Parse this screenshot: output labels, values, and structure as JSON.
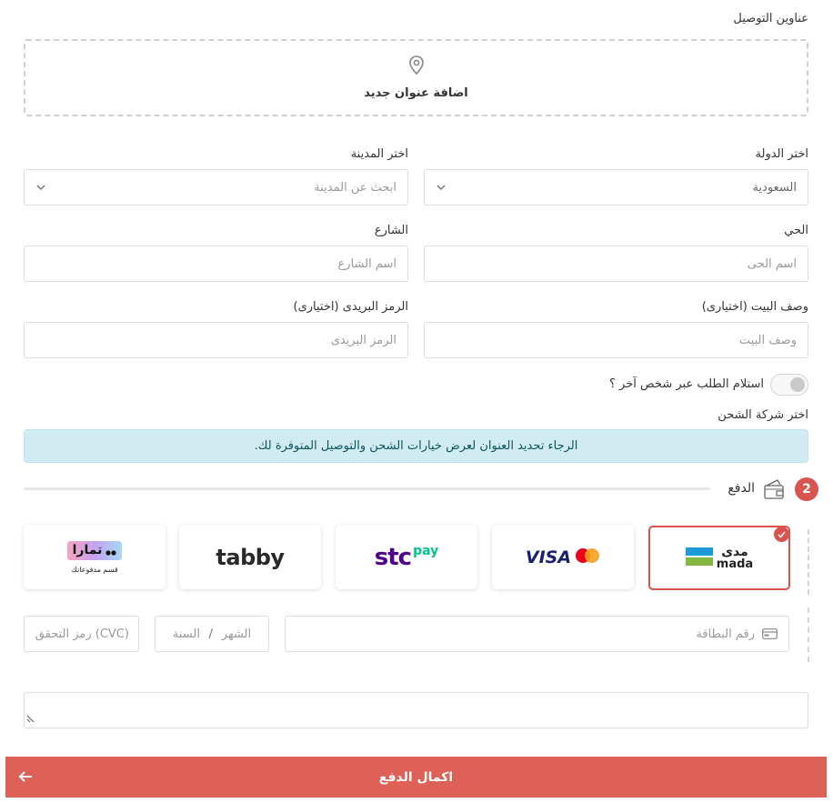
{
  "addresses": {
    "title": "عناوين التوصيل",
    "add_new_label": "اضافة عنوان جديد"
  },
  "form": {
    "country_label": "اختر الدولة",
    "country_value": "السعودية",
    "city_label": "اختر المدينة",
    "city_placeholder": "ابحث عن المدينة",
    "district_label": "الحي",
    "district_placeholder": "اسم الحى",
    "street_label": "الشارع",
    "street_placeholder": "اسم الشارع",
    "house_desc_label": "وصف البيت (اختيارى)",
    "house_desc_placeholder": "وصف البيت",
    "postal_label": "الرمز البريدى (اختيارى)",
    "postal_placeholder": "الرمز البريدى",
    "other_person_toggle_label": "استلام الطلب عبر شخص آخر ؟",
    "other_person_toggle_on": false
  },
  "shipping": {
    "title": "اختر شركة الشحن",
    "notice": "الرجاء تحديد العنوان لعرض خيارات الشحن والتوصيل المتوفرة لك."
  },
  "payment": {
    "step_number": "2",
    "title": "الدفع",
    "methods": [
      {
        "id": "mada",
        "label_ar": "مدى",
        "label_en": "mada",
        "selected": true
      },
      {
        "id": "visa-mastercard",
        "label": "VISA",
        "selected": false
      },
      {
        "id": "stcpay",
        "label": "stc",
        "sub": "pay",
        "selected": false
      },
      {
        "id": "tabby",
        "label": "tabby",
        "selected": false
      },
      {
        "id": "tamara",
        "label": "تمارا",
        "sub": "قسم مدفوعاتك",
        "selected": false
      }
    ],
    "card_number_placeholder": "رقم البطاقة",
    "month_placeholder": "الشهر",
    "separator": "/",
    "year_placeholder": "السنة",
    "cvc_placeholder": "(CVC) رمز التحقق"
  },
  "submit": {
    "label": "اكمال الدفع"
  },
  "colors": {
    "accent": "#dd6157",
    "badge": "#d9534f",
    "alert_bg": "#d1ecf1",
    "alert_text": "#0c5460",
    "mada_blue": "#1d9ad8",
    "mada_green": "#84b740",
    "stc_purple": "#4f008c",
    "stc_green": "#00c48c"
  }
}
